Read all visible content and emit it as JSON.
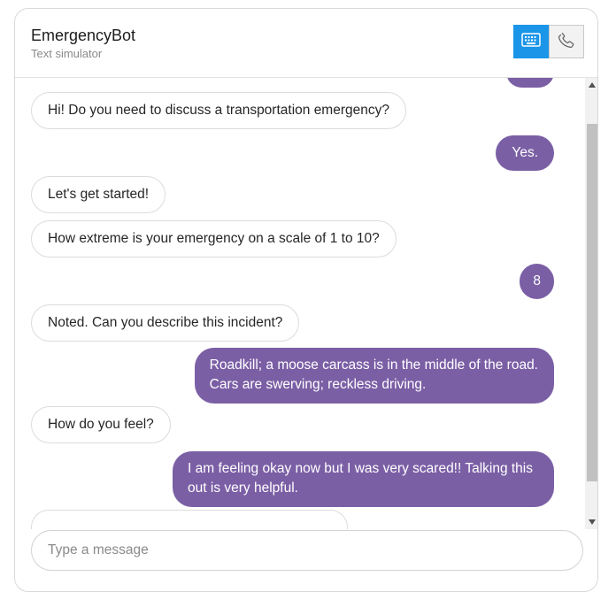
{
  "header": {
    "title": "EmergencyBot",
    "subtitle": "Text simulator",
    "modes": [
      {
        "name": "text-mode",
        "icon": "keyboard-icon",
        "active": true
      },
      {
        "name": "voice-mode",
        "icon": "phone-icon",
        "active": false
      }
    ]
  },
  "messages": [
    {
      "sender": "bot",
      "text": "Hi! Do you need to discuss a transportation emergency?"
    },
    {
      "sender": "user",
      "text": "Yes."
    },
    {
      "sender": "bot",
      "text": "Let's get started!"
    },
    {
      "sender": "bot",
      "text": "How extreme is your emergency on a scale of 1 to 10?"
    },
    {
      "sender": "user",
      "text": "8"
    },
    {
      "sender": "bot",
      "text": "Noted. Can you describe this incident?"
    },
    {
      "sender": "user",
      "lines": [
        "Roadkill; a moose carcass is in the middle of the road.",
        "Cars are swerving; reckless driving."
      ]
    },
    {
      "sender": "bot",
      "text": "How do you feel?"
    },
    {
      "sender": "user",
      "lines": [
        "I am feeling okay now but I was very scared!! Talking this",
        "out is very helpful."
      ]
    }
  ],
  "composer": {
    "placeholder": "Type a message"
  },
  "colors": {
    "accent": "#1a95e8",
    "user_bubble": "#7b5fa5"
  }
}
